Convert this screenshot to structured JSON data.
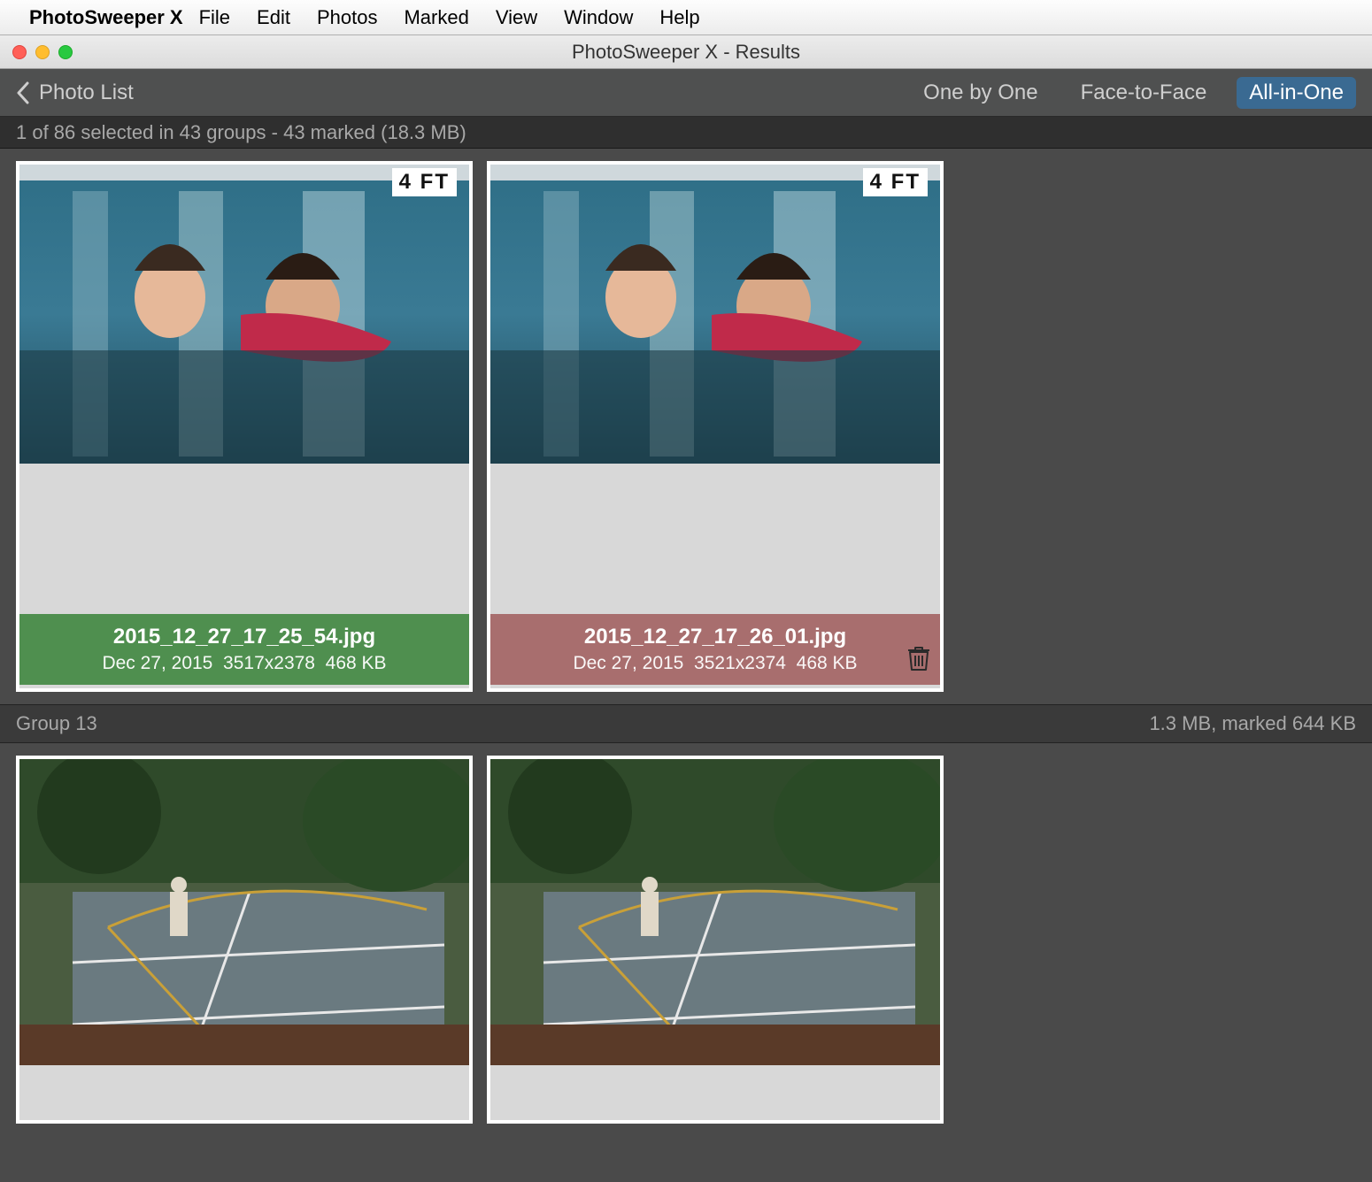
{
  "menubar": {
    "app": "PhotoSweeper X",
    "items": [
      "File",
      "Edit",
      "Photos",
      "Marked",
      "View",
      "Window",
      "Help"
    ]
  },
  "window": {
    "title": "PhotoSweeper X - Results"
  },
  "toolbar": {
    "back_label": "Photo List",
    "views": {
      "one": "One by One",
      "face": "Face-to-Face",
      "all": "All-in-One",
      "active": "all"
    }
  },
  "status": "1 of 86 selected in 43 groups - 43 marked (18.3 MB)",
  "group1": {
    "photos": [
      {
        "filename": "2015_12_27_17_25_54.jpg",
        "date": "Dec 27, 2015",
        "dims": "3517x2378",
        "size": "468 KB",
        "marked": false,
        "depth_sign": "4 FT"
      },
      {
        "filename": "2015_12_27_17_26_01.jpg",
        "date": "Dec 27, 2015",
        "dims": "3521x2374",
        "size": "468 KB",
        "marked": true,
        "depth_sign": "4 FT"
      }
    ]
  },
  "group2": {
    "header_left": "Group 13",
    "header_right": "1.3 MB, marked 644 KB"
  }
}
